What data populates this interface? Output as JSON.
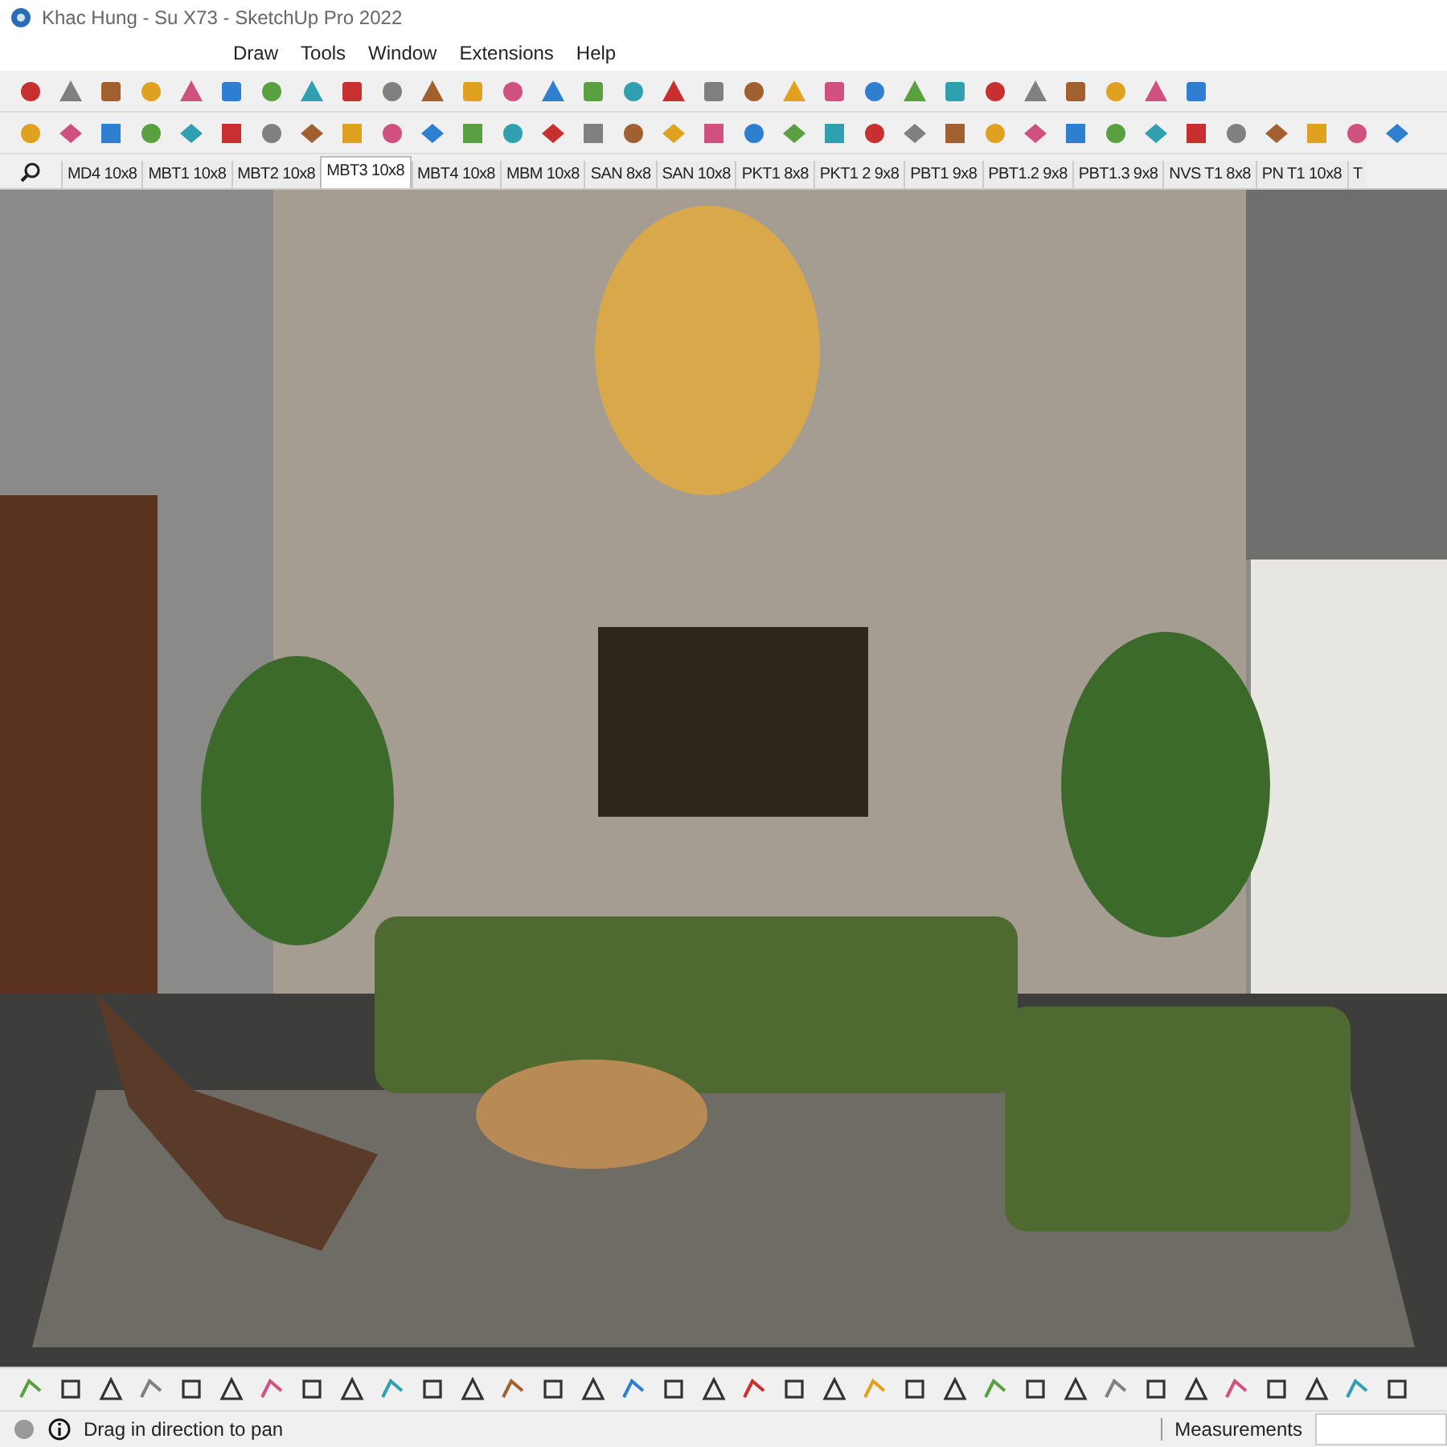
{
  "window": {
    "title": "Khac Hung - Su X73 - SketchUp Pro 2022"
  },
  "menu": [
    "Draw",
    "Tools",
    "Window",
    "Extensions",
    "Help"
  ],
  "scene_tabs": [
    {
      "label": "MD4 10x8",
      "selected": false
    },
    {
      "label": "MBT1 10x8",
      "selected": false
    },
    {
      "label": "MBT2 10x8",
      "selected": false
    },
    {
      "label": "MBT3 10x8",
      "selected": true
    },
    {
      "label": "MBT4 10x8",
      "selected": false
    },
    {
      "label": "MBM 10x8",
      "selected": false
    },
    {
      "label": "SAN 8x8",
      "selected": false
    },
    {
      "label": "SAN 10x8",
      "selected": false
    },
    {
      "label": "PKT1 8x8",
      "selected": false
    },
    {
      "label": "PKT1 2 9x8",
      "selected": false
    },
    {
      "label": "PBT1 9x8",
      "selected": false
    },
    {
      "label": "PBT1.2 9x8",
      "selected": false
    },
    {
      "label": "PBT1.3 9x8",
      "selected": false
    },
    {
      "label": "NVS T1 8x8",
      "selected": false
    },
    {
      "label": "PN T1 10x8",
      "selected": false
    },
    {
      "label": "T",
      "selected": false
    }
  ],
  "status_bar": {
    "hint": "Drag in direction to pan",
    "measurements_label": "Measurements"
  }
}
